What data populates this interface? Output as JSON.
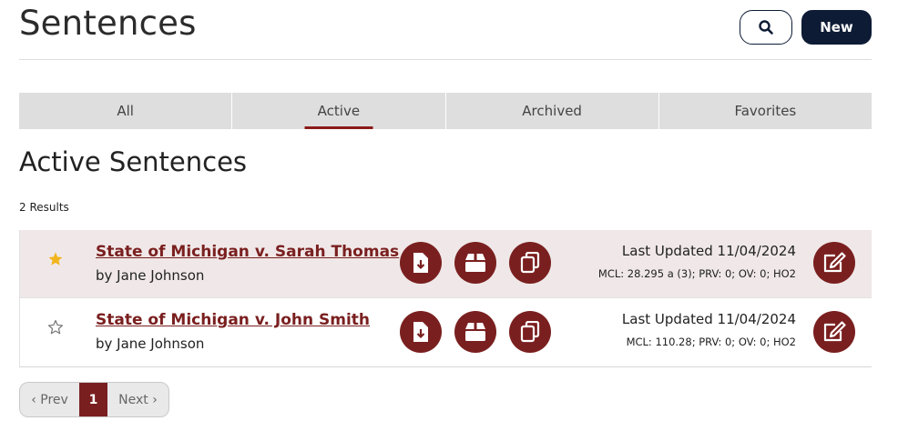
{
  "header": {
    "title": "Sentences",
    "new_label": "New"
  },
  "tabs": [
    {
      "label": "All"
    },
    {
      "label": "Active"
    },
    {
      "label": "Archived"
    },
    {
      "label": "Favorites"
    }
  ],
  "active_tab": "Active",
  "section": {
    "title": "Active Sentences",
    "results": "2 Results"
  },
  "rows": [
    {
      "favorite": true,
      "title": "State of Michigan v. Sarah Thomas",
      "author": "by Jane Johnson",
      "updated": "Last Updated 11/04/2024",
      "codes": "MCL: 28.295 a (3); PRV: 0; OV: 0; HO2"
    },
    {
      "favorite": false,
      "title": "State of Michigan v. John Smith",
      "author": "by Jane Johnson",
      "updated": "Last Updated 11/04/2024",
      "codes": "MCL: 110.28; PRV: 0; OV: 0; HO2"
    }
  ],
  "pagination": {
    "prev": "‹ Prev",
    "current": "1",
    "next": "Next ›"
  },
  "colors": {
    "navy": "#0d1b35",
    "maroon": "#7a1f1f",
    "star_active": "#f2b51d",
    "row_highlight": "#f0e8e8"
  },
  "icons": {
    "search": "search-icon",
    "favorite": "star-icon",
    "download": "file-download-icon",
    "archive": "archive-box-icon",
    "copy": "copy-icon",
    "edit": "edit-icon"
  }
}
